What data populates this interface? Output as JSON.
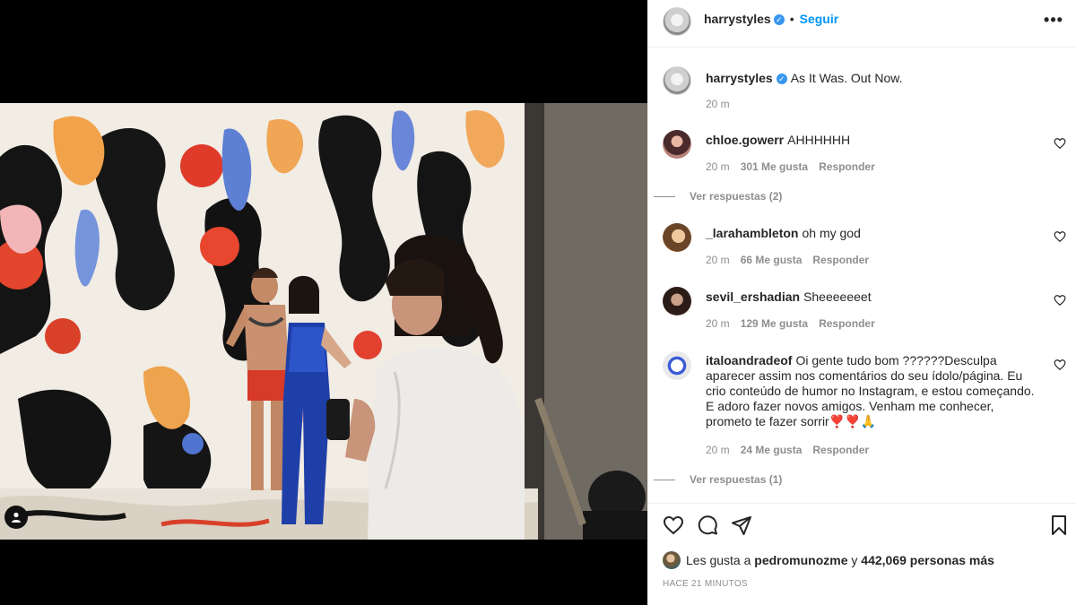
{
  "post": {
    "author": "harrystyles",
    "follow_label": "Seguir",
    "separator": "•",
    "more_label": "•••",
    "caption": "As It Was. Out Now.",
    "caption_time": "20 m"
  },
  "comments": [
    {
      "user": "chloe.gowerr",
      "text": "AHHHHHH",
      "time": "20 m",
      "likes": "301 Me gusta",
      "reply": "Responder",
      "replies": "Ver respuestas (2)"
    },
    {
      "user": "_larahambleton",
      "text": "oh my god",
      "time": "20 m",
      "likes": "66 Me gusta",
      "reply": "Responder"
    },
    {
      "user": "sevil_ershadian",
      "text": "Sheeeeeeet",
      "time": "20 m",
      "likes": "129 Me gusta",
      "reply": "Responder"
    },
    {
      "user": "italoandradeof",
      "text": "Oi gente tudo bom ??????Desculpa aparecer assim nos comentários do seu ídolo/página. Eu crio conteúdo de humor no Instagram, e estou começando. E adoro fazer novos amigos. Venham me conhecer, prometo te fazer sorrir❣️❣️🙏",
      "time": "20 m",
      "likes": "24 Me gusta",
      "reply": "Responder",
      "replies": "Ver respuestas (1)"
    }
  ],
  "likes_bar": {
    "prefix": "Les gusta a",
    "user": "pedromunozme",
    "middle": "y",
    "count": "442,069 personas más"
  },
  "timestamp": "HACE 21 MINUTOS",
  "icons": {
    "verified": "verified-badge-icon",
    "more": "more-options-icon",
    "like": "heart-icon",
    "comment": "comment-icon",
    "share": "share-icon",
    "save": "bookmark-icon",
    "tag": "user-tag-icon"
  },
  "colors": {
    "accent": "#0095f6",
    "verified": "#3897f0",
    "text": "#262626",
    "secondary": "#8e8e8e"
  }
}
